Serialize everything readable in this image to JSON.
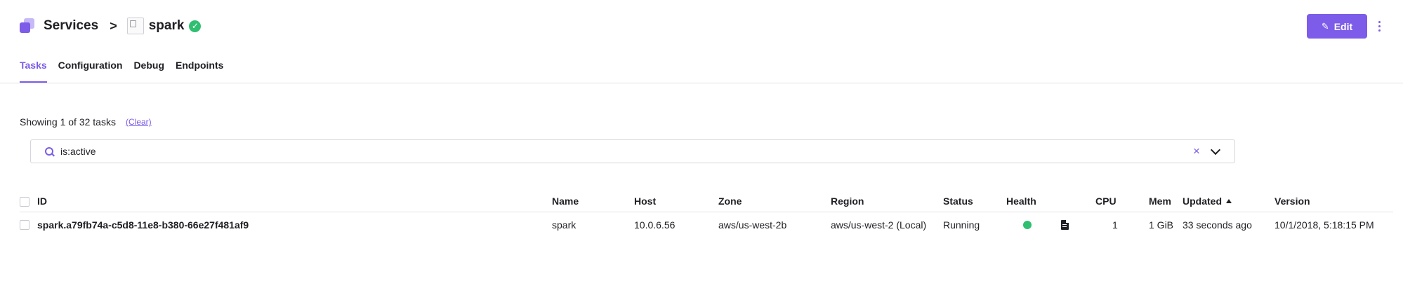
{
  "header": {
    "breadcrumb_root": "Services",
    "breadcrumb_separator": ">",
    "service_name": "spark",
    "status_check": "✓",
    "edit_label": "Edit"
  },
  "tabs": [
    {
      "label": "Tasks",
      "active": true
    },
    {
      "label": "Configuration",
      "active": false
    },
    {
      "label": "Debug",
      "active": false
    },
    {
      "label": "Endpoints",
      "active": false
    }
  ],
  "filter": {
    "summary": "Showing 1 of 32 tasks",
    "clear_label": "(Clear)",
    "search_value": "is:active",
    "clear_icon": "×"
  },
  "table": {
    "columns": {
      "id": "ID",
      "name": "Name",
      "host": "Host",
      "zone": "Zone",
      "region": "Region",
      "status": "Status",
      "health": "Health",
      "cpu": "CPU",
      "mem": "Mem",
      "updated": "Updated",
      "version": "Version"
    },
    "sort": {
      "column": "updated",
      "direction": "ascending"
    },
    "rows": [
      {
        "id": "spark.a79fb74a-c5d8-11e8-b380-66e27f481af9",
        "name": "spark",
        "host": "10.0.6.56",
        "zone": "aws/us-west-2b",
        "region": "aws/us-west-2 (Local)",
        "status": "Running",
        "health": "healthy",
        "cpu": "1",
        "mem": "1 GiB",
        "updated": "33 seconds ago",
        "version": "10/1/2018, 5:18:15 PM"
      }
    ]
  },
  "colors": {
    "accent": "#7c5ce8",
    "healthy": "#2fbf71",
    "text": "#1f1f24",
    "divider": "#e3e3e8"
  },
  "icons": {
    "services": "services-icon",
    "service_image": "service-image-icon",
    "status": "check-circle-icon",
    "edit": "pencil-icon",
    "more": "more-vertical-icon",
    "search": "search-icon",
    "clear": "close-icon",
    "expand": "chevron-down-icon",
    "logs": "file-icon",
    "health": "health-dot-icon",
    "sort": "sort-ascending-icon"
  }
}
